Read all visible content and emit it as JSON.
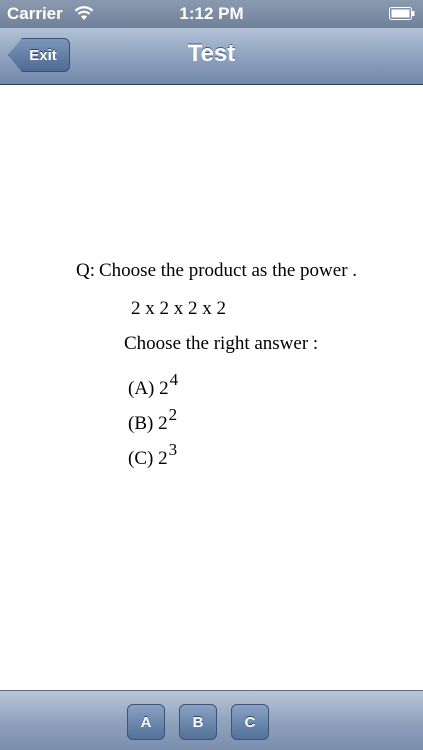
{
  "status_bar": {
    "carrier": "Carrier",
    "time": "1:12 PM",
    "wifi_icon": "wifi-icon",
    "battery_icon": "battery-icon"
  },
  "nav": {
    "exit_label": "Exit",
    "title": "Test"
  },
  "question": {
    "label": "Q:",
    "text": "Choose the product as the power .",
    "expression": "2 x 2 x 2 x 2",
    "instruction": "Choose the right answer :",
    "options": [
      {
        "prefix": "(A) 2",
        "exponent": "4"
      },
      {
        "prefix": "(B) 2",
        "exponent": "2"
      },
      {
        "prefix": "(C) 2",
        "exponent": "3"
      }
    ]
  },
  "toolbar": {
    "buttons": [
      "A",
      "B",
      "C"
    ]
  },
  "colors": {
    "nav_bar": "#8fa3bf",
    "button": "#52719a",
    "text": "#000000"
  }
}
